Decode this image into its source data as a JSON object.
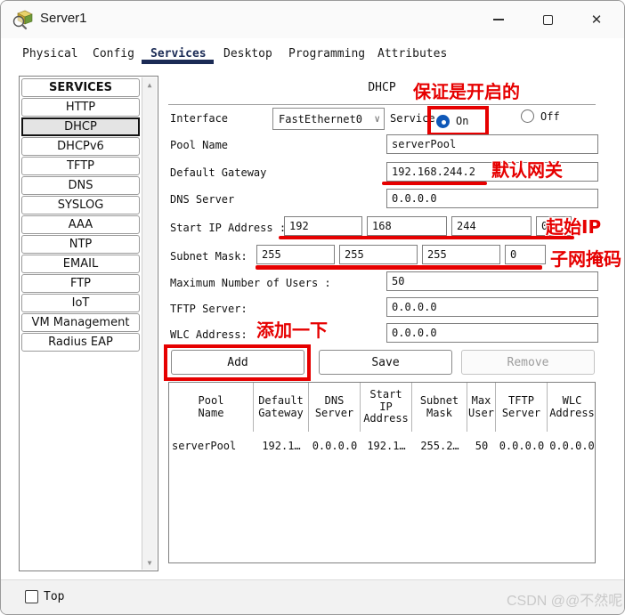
{
  "window": {
    "title": "Server1"
  },
  "icons": {
    "close": "✕",
    "chevron_down": "∨",
    "scroll_up": "▲",
    "scroll_down": "▼"
  },
  "tabs": {
    "items": [
      "Physical",
      "Config",
      "Services",
      "Desktop",
      "Programming",
      "Attributes"
    ],
    "active": "Services"
  },
  "sidebar": {
    "header": "SERVICES",
    "items": [
      "HTTP",
      "DHCP",
      "DHCPv6",
      "TFTP",
      "DNS",
      "SYSLOG",
      "AAA",
      "NTP",
      "EMAIL",
      "FTP",
      "IoT",
      "VM Management",
      "Radius EAP"
    ],
    "active": "DHCP"
  },
  "dhcp": {
    "title": "DHCP",
    "interface_label": "Interface",
    "interface_value": "FastEthernet0",
    "service_label": "Service",
    "on_label": "On",
    "off_label": "Off",
    "service_selected": "On",
    "pool_name_label": "Pool Name",
    "pool_name_value": "serverPool",
    "default_gateway_label": "Default Gateway",
    "default_gateway_value": "192.168.244.2",
    "dns_server_label": "DNS Server",
    "dns_server_value": "0.0.0.0",
    "start_ip_label": "Start IP Address :",
    "start_ip": [
      "192",
      "168",
      "244",
      "0"
    ],
    "subnet_mask_label": "Subnet Mask:",
    "subnet_mask": [
      "255",
      "255",
      "255",
      "0"
    ],
    "max_users_label": "Maximum Number of Users :",
    "max_users_value": "50",
    "tftp_label": "TFTP Server:",
    "tftp_value": "0.0.0.0",
    "wlc_label": "WLC Address:",
    "wlc_value": "0.0.0.0",
    "add_label": "Add",
    "save_label": "Save",
    "remove_label": "Remove"
  },
  "pool_table": {
    "columns": [
      "Pool\nName",
      "Default\nGateway",
      "DNS\nServer",
      "Start\nIP\nAddress",
      "Subnet\nMask",
      "Max\nUser",
      "TFTP\nServer",
      "WLC\nAddress"
    ],
    "row": [
      "serverPool",
      "192.1…",
      "0.0.0.0",
      "192.1…",
      "255.2…",
      "50",
      "0.0.0.0",
      "0.0.0.0"
    ]
  },
  "annotations": {
    "color": "#e60000",
    "service_on": "保证是开启的",
    "default_gateway": "默认网关",
    "start_ip": "起始IP",
    "subnet_mask": "子网掩码",
    "add": "添加一下"
  },
  "footer": {
    "top_label": "Top",
    "watermark": "CSDN @@不然呢"
  }
}
